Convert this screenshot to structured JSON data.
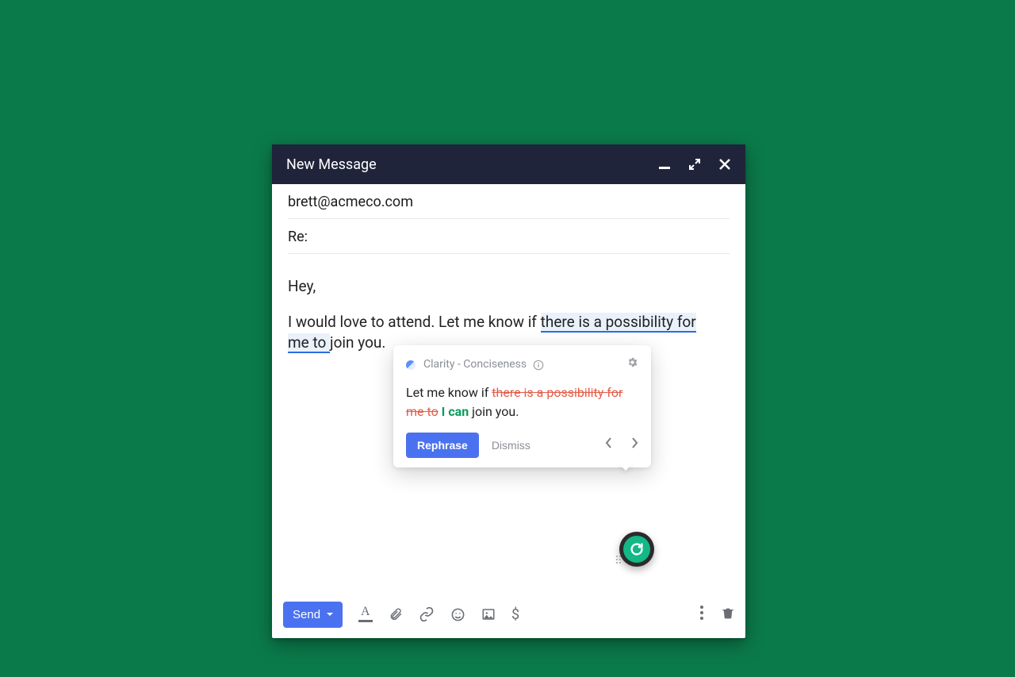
{
  "window": {
    "title": "New Message"
  },
  "fields": {
    "to": "brett@acmeco.com",
    "subject": "Re:"
  },
  "body": {
    "greeting": "Hey,",
    "line_prefix": "I would love to attend. Let me know if ",
    "highlight1": "there is a possibility for ",
    "highlight2": "me to ",
    "line_suffix": "join you."
  },
  "suggestion": {
    "category": "Clarity - Conciseness",
    "text_prefix": "Let me know if ",
    "strike": "there is a possibility for me to",
    "insert": "I can",
    "text_suffix": " join you.",
    "rephrase_label": "Rephrase",
    "dismiss_label": "Dismiss"
  },
  "toolbar": {
    "send_label": "Send"
  }
}
